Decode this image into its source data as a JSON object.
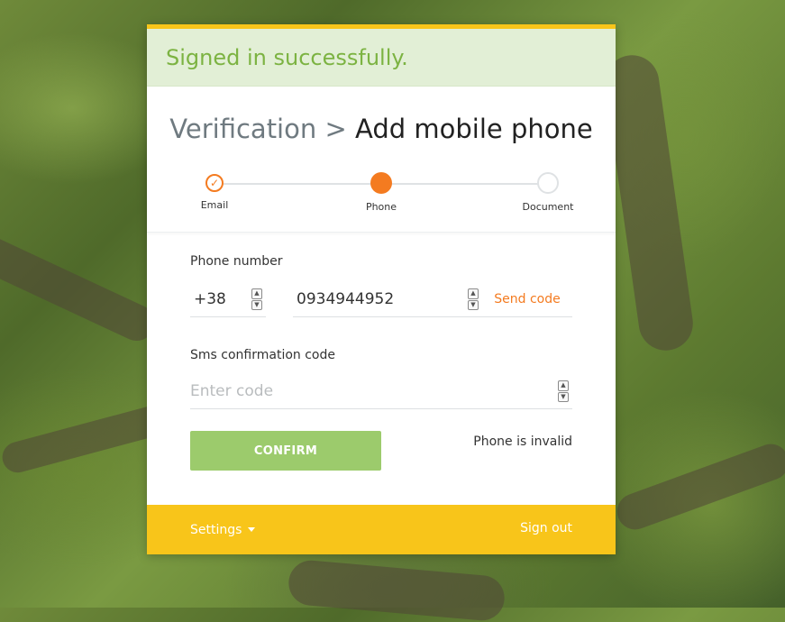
{
  "alert": {
    "message": "Signed in successfully."
  },
  "title": {
    "crumb": "Verification",
    "separator": ">",
    "current": "Add mobile phone"
  },
  "stepper": {
    "steps": [
      {
        "label": "Email",
        "state": "done"
      },
      {
        "label": "Phone",
        "state": "active"
      },
      {
        "label": "Document",
        "state": "todo"
      }
    ],
    "check_glyph": "✓"
  },
  "phone": {
    "label": "Phone number",
    "country_code": "+38",
    "number": "0934944952",
    "send_code": "Send code"
  },
  "sms": {
    "label": "Sms confirmation code",
    "placeholder": "Enter code"
  },
  "actions": {
    "confirm": "CONFIRM",
    "error": "Phone is invalid"
  },
  "footer": {
    "settings": "Settings",
    "sign_out": "Sign out"
  },
  "colors": {
    "accent": "#f47b20",
    "success": "#7cb342",
    "footer": "#f8c51a",
    "confirm": "#9ccb6c"
  }
}
